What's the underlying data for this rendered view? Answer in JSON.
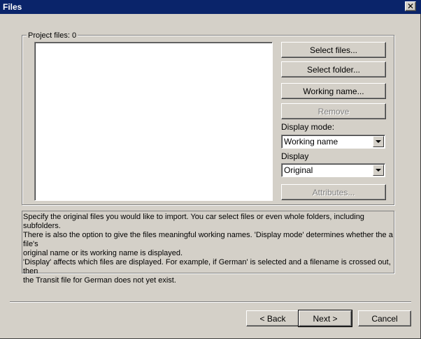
{
  "window": {
    "title": "Files",
    "close_glyph": "✕"
  },
  "project_files": {
    "label": "Project files: 0"
  },
  "side_buttons": {
    "select_files": "Select files...",
    "select_folder": "Select folder...",
    "working_name": "Working name...",
    "remove": "Remove",
    "attributes": "Attributes..."
  },
  "display_mode": {
    "label": "Display mode:",
    "selected": "Working name"
  },
  "display": {
    "label": "Display",
    "selected": "Original"
  },
  "description": {
    "text": "Specify the original files you would like to import. You car select files or even whole folders, including subfolders.\nThere is also the option to give the files meaningful working names. 'Display mode' determines whether the a file's\noriginal name or its working name is displayed.\n'Display' affects which files are displayed. For example, if German' is selected and a filename is crossed out, then\nthe Transit file for German does not yet exist."
  },
  "footer": {
    "back": "< Back",
    "next": "Next >",
    "cancel": "Cancel"
  },
  "colors": {
    "title_bar": "#0a246a",
    "window_face": "#d4d0c8"
  }
}
